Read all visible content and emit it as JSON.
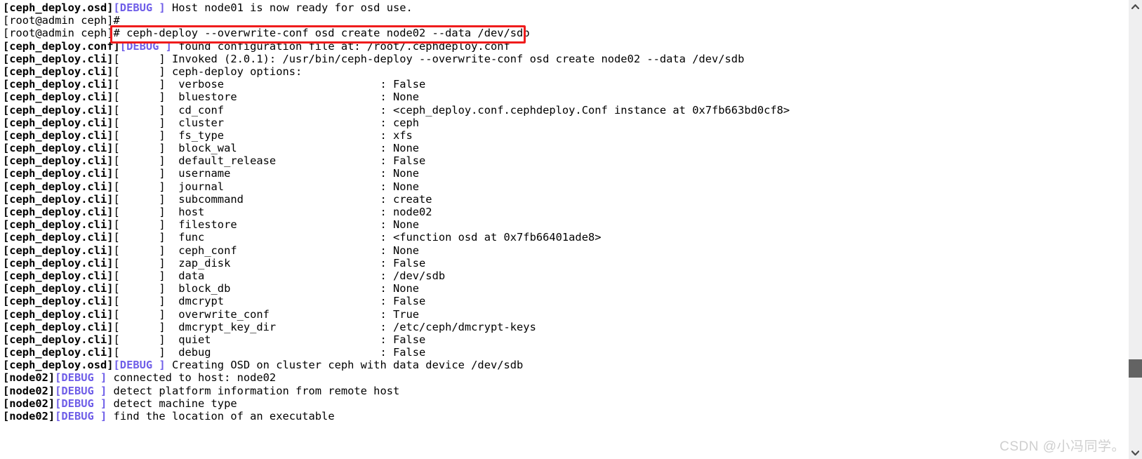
{
  "terminal": {
    "lines": [
      {
        "kind": "log",
        "source": "[ceph_deploy.osd]",
        "level": "[DEBUG ]",
        "text": " Host node01 is now ready for osd use."
      },
      {
        "kind": "prompt",
        "prompt": "[root@admin ceph]#",
        "command": ""
      },
      {
        "kind": "prompt",
        "prompt": "[root@admin ceph]#",
        "command": " ceph-deploy --overwrite-conf osd create node02 --data /dev/sdb"
      },
      {
        "kind": "log",
        "source": "[ceph_deploy.conf]",
        "level": "[DEBUG ]",
        "text": " found configuration file at: /root/.cephdeploy.conf"
      },
      {
        "kind": "log",
        "source": "[ceph_deploy.cli]",
        "level": "[      ]",
        "text": " Invoked (2.0.1): /usr/bin/ceph-deploy --overwrite-conf osd create node02 --data /dev/sdb"
      },
      {
        "kind": "log",
        "source": "[ceph_deploy.cli]",
        "level": "[      ]",
        "text": " ceph-deploy options:"
      },
      {
        "kind": "opt",
        "source": "[ceph_deploy.cli]",
        "level": "[      ]",
        "key": "verbose",
        "value": "False"
      },
      {
        "kind": "opt",
        "source": "[ceph_deploy.cli]",
        "level": "[      ]",
        "key": "bluestore",
        "value": "None"
      },
      {
        "kind": "opt",
        "source": "[ceph_deploy.cli]",
        "level": "[      ]",
        "key": "cd_conf",
        "value": "<ceph_deploy.conf.cephdeploy.Conf instance at 0x7fb663bd0cf8>"
      },
      {
        "kind": "opt",
        "source": "[ceph_deploy.cli]",
        "level": "[      ]",
        "key": "cluster",
        "value": "ceph"
      },
      {
        "kind": "opt",
        "source": "[ceph_deploy.cli]",
        "level": "[      ]",
        "key": "fs_type",
        "value": "xfs"
      },
      {
        "kind": "opt",
        "source": "[ceph_deploy.cli]",
        "level": "[      ]",
        "key": "block_wal",
        "value": "None"
      },
      {
        "kind": "opt",
        "source": "[ceph_deploy.cli]",
        "level": "[      ]",
        "key": "default_release",
        "value": "False"
      },
      {
        "kind": "opt",
        "source": "[ceph_deploy.cli]",
        "level": "[      ]",
        "key": "username",
        "value": "None"
      },
      {
        "kind": "opt",
        "source": "[ceph_deploy.cli]",
        "level": "[      ]",
        "key": "journal",
        "value": "None"
      },
      {
        "kind": "opt",
        "source": "[ceph_deploy.cli]",
        "level": "[      ]",
        "key": "subcommand",
        "value": "create"
      },
      {
        "kind": "opt",
        "source": "[ceph_deploy.cli]",
        "level": "[      ]",
        "key": "host",
        "value": "node02"
      },
      {
        "kind": "opt",
        "source": "[ceph_deploy.cli]",
        "level": "[      ]",
        "key": "filestore",
        "value": "None"
      },
      {
        "kind": "opt",
        "source": "[ceph_deploy.cli]",
        "level": "[      ]",
        "key": "func",
        "value": "<function osd at 0x7fb66401ade8>"
      },
      {
        "kind": "opt",
        "source": "[ceph_deploy.cli]",
        "level": "[      ]",
        "key": "ceph_conf",
        "value": "None"
      },
      {
        "kind": "opt",
        "source": "[ceph_deploy.cli]",
        "level": "[      ]",
        "key": "zap_disk",
        "value": "False"
      },
      {
        "kind": "opt",
        "source": "[ceph_deploy.cli]",
        "level": "[      ]",
        "key": "data",
        "value": "/dev/sdb"
      },
      {
        "kind": "opt",
        "source": "[ceph_deploy.cli]",
        "level": "[      ]",
        "key": "block_db",
        "value": "None"
      },
      {
        "kind": "opt",
        "source": "[ceph_deploy.cli]",
        "level": "[      ]",
        "key": "dmcrypt",
        "value": "False"
      },
      {
        "kind": "opt",
        "source": "[ceph_deploy.cli]",
        "level": "[      ]",
        "key": "overwrite_conf",
        "value": "True"
      },
      {
        "kind": "opt",
        "source": "[ceph_deploy.cli]",
        "level": "[      ]",
        "key": "dmcrypt_key_dir",
        "value": "/etc/ceph/dmcrypt-keys"
      },
      {
        "kind": "opt",
        "source": "[ceph_deploy.cli]",
        "level": "[      ]",
        "key": "quiet",
        "value": "False"
      },
      {
        "kind": "opt",
        "source": "[ceph_deploy.cli]",
        "level": "[      ]",
        "key": "debug",
        "value": "False"
      },
      {
        "kind": "log",
        "source": "[ceph_deploy.osd]",
        "level": "[DEBUG ]",
        "text": " Creating OSD on cluster ceph with data device /dev/sdb"
      },
      {
        "kind": "log",
        "source": "[node02]",
        "level": "[DEBUG ]",
        "text": " connected to host: node02"
      },
      {
        "kind": "log",
        "source": "[node02]",
        "level": "[DEBUG ]",
        "text": " detect platform information from remote host"
      },
      {
        "kind": "log",
        "source": "[node02]",
        "level": "[DEBUG ]",
        "text": " detect machine type"
      },
      {
        "kind": "log",
        "source": "[node02]",
        "level": "[DEBUG ]",
        "text": " find the location of an executable"
      }
    ],
    "option_key_column": 26,
    "option_value_column": 59
  },
  "highlight": {
    "color": "#ef1c1c",
    "command": "ceph-deploy --overwrite-conf osd create node02 --data /dev/sdb"
  },
  "scrollbar": {
    "up_arrow": "chevron-up-icon",
    "down_arrow": "chevron-down-icon",
    "thumb_color": "#636363",
    "track_color": "#efeff0"
  },
  "watermark": {
    "text": "CSDN @小冯同学。"
  },
  "colors": {
    "background": "#ffffff",
    "text": "#000000",
    "debug": "#6f5ee8",
    "highlight": "#ef1c1c"
  }
}
